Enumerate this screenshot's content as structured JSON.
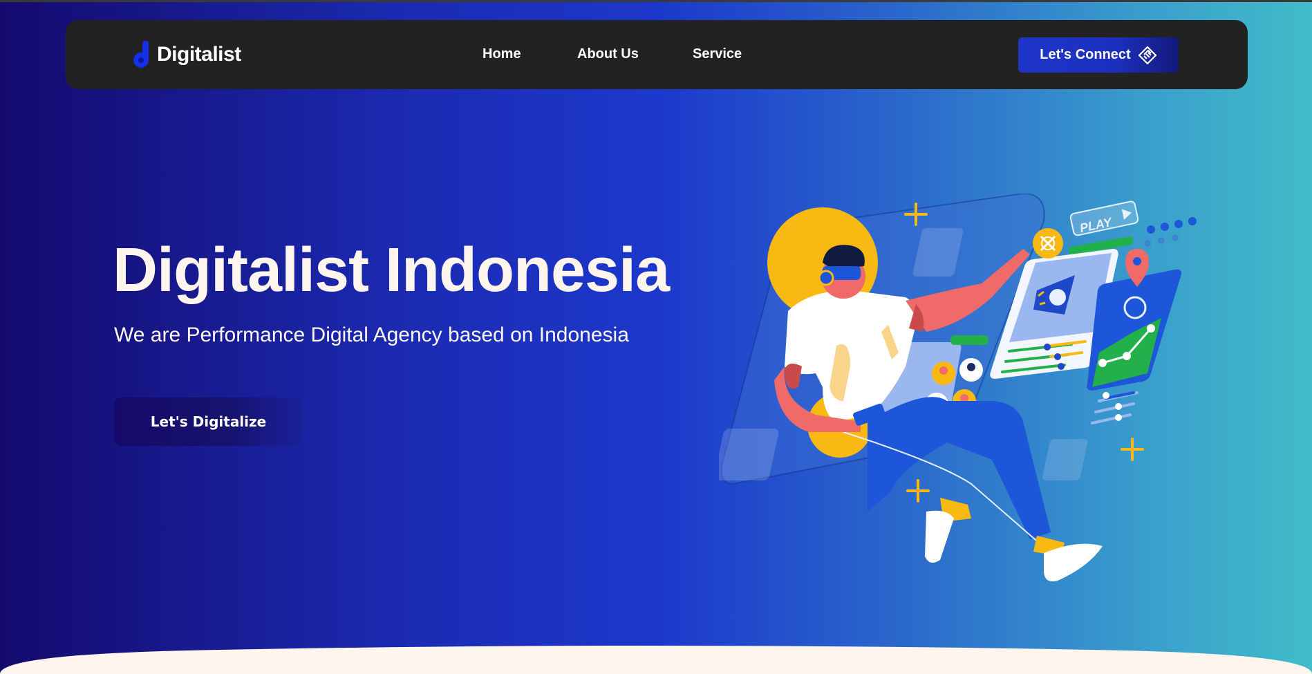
{
  "brand": {
    "name": "Digitalist"
  },
  "nav": {
    "home": "Home",
    "about": "About Us",
    "service": "Service",
    "connect_label": "Let's Connect"
  },
  "hero": {
    "title": "Digitalist Indonesia",
    "subtitle": "We are Performance Digital Agency based on Indonesia",
    "cta_label": "Let's Digitalize"
  },
  "illustration": {
    "play_label": "PLAY"
  },
  "colors": {
    "navbar": "#222222",
    "accent_blue": "#1e35c8",
    "hero_text": "#fdf5ee",
    "cta_dark": "#150a6a",
    "illustration_yellow": "#f8b912"
  }
}
